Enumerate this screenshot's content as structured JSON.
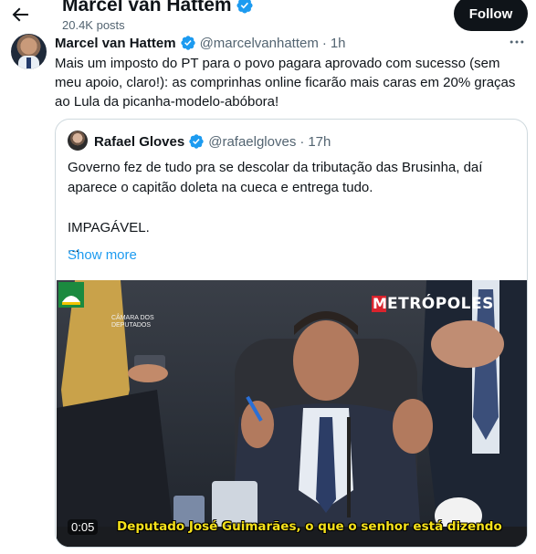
{
  "header": {
    "display_name": "Marcel van Hattem",
    "post_count": "20.4K posts",
    "follow_label": "Follow"
  },
  "tweet": {
    "author_name": "Marcel van Hattem",
    "handle": "@marcelvanhattem",
    "separator": "·",
    "time": "1h",
    "text": "Mais um imposto do PT para o povo pagara aprovado com sucesso (sem meu apoio, claro!): as comprinhas online ficarão mais caras em 20% graças ao Lula da picanha-modelo-abóbora!"
  },
  "quoted": {
    "author_name": "Rafael Gloves",
    "handle": "@rafaelgloves",
    "separator": "·",
    "time": "17h",
    "lines": [
      "Governo fez de tudo pra se descolar da tributação das Brusinha, daí aparece o capitão doleta na cueca e entrega tudo.",
      "",
      "IMPAGÁVEL.",
      "..."
    ],
    "show_more": "Show more",
    "video": {
      "timestamp": "0:05",
      "subtitle": "Deputado José Guimarães, o que o senhor está dizendo",
      "channel_logo_text": "ETRÓPOLES",
      "camara_text": "CÂMARA DOS DEPUTADOS"
    }
  },
  "icons": {
    "back": "arrow-left-icon",
    "verified": "verified-badge-icon",
    "more": "more-horizontal-icon"
  },
  "colors": {
    "accent": "#1d9bf0",
    "text": "#0f1419",
    "secondary": "#536471",
    "border": "#cfd9de",
    "follow_bg": "#0f1419"
  }
}
